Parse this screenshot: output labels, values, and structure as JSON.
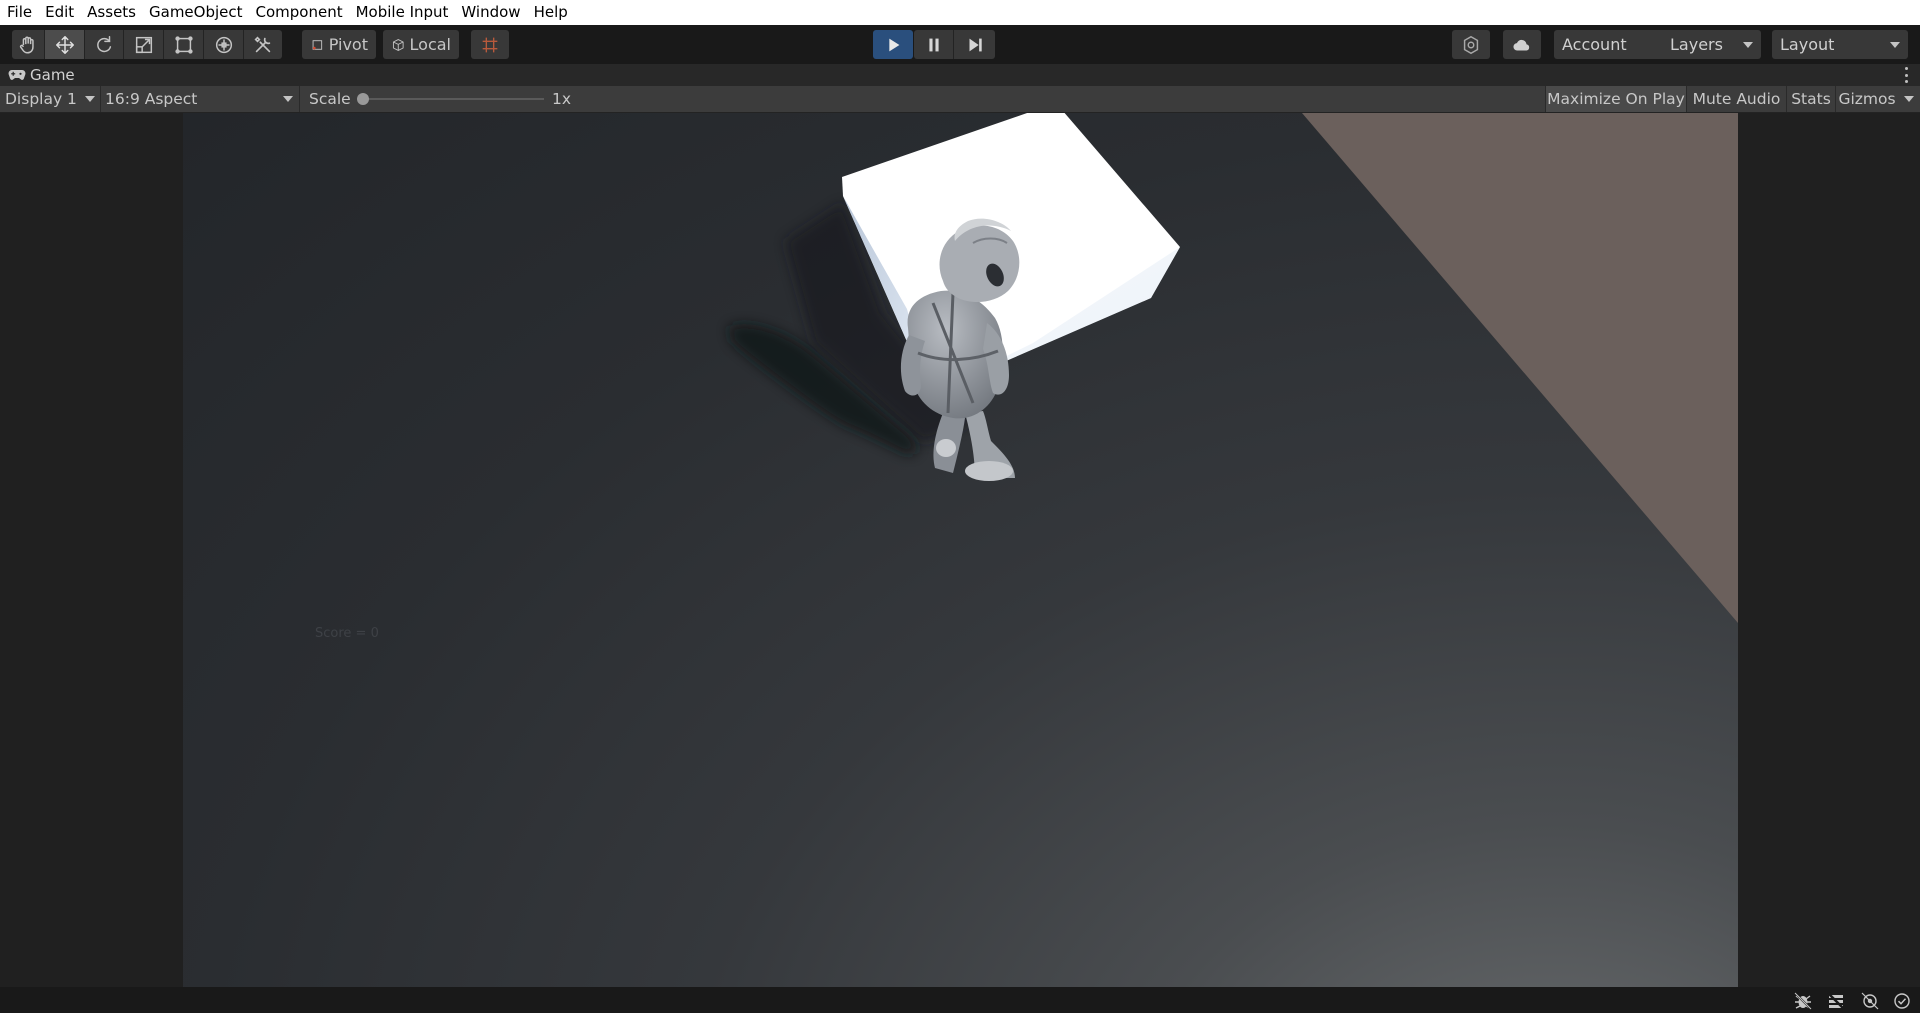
{
  "menu": {
    "items": [
      "File",
      "Edit",
      "Assets",
      "GameObject",
      "Component",
      "Mobile Input",
      "Window",
      "Help"
    ]
  },
  "toolbar": {
    "pivot_label": "Pivot",
    "local_label": "Local",
    "account_label": "Account",
    "layers_label": "Layers",
    "layout_label": "Layout",
    "play_state": "playing"
  },
  "tab": {
    "title": "Game"
  },
  "game_controls": {
    "display": "Display 1",
    "aspect": "16:9 Aspect",
    "scale_label": "Scale",
    "scale_value": "1x",
    "maximize_on_play": "Maximize On Play",
    "mute_audio": "Mute Audio",
    "stats": "Stats",
    "gizmos": "Gizmos"
  },
  "game_view": {
    "score_text": "Score = 0"
  },
  "colors": {
    "accent_play": "#2a4f7d",
    "toolbar_bg": "#191919",
    "button_bg": "#383838",
    "wall_color": "#6b605c",
    "cube_color": "#ffffff"
  }
}
